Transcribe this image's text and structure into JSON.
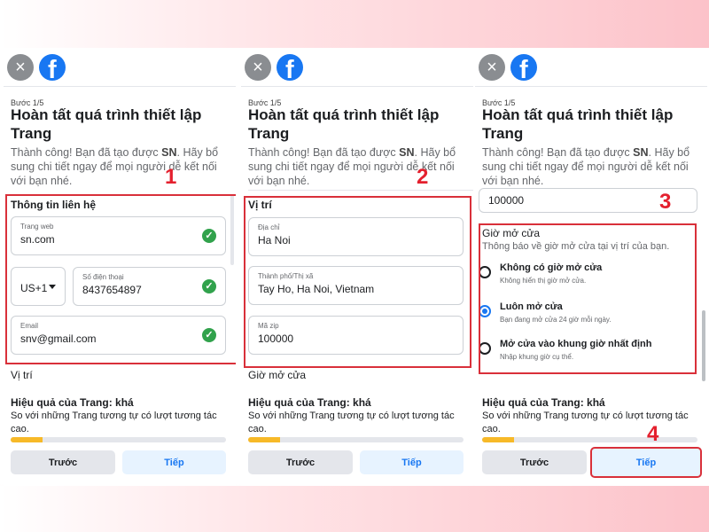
{
  "common": {
    "step": "Bước 1/5",
    "title": "Hoàn tất quá trình thiết lập Trang",
    "subtitle_before": "Thành công! Bạn đã tạo được ",
    "subtitle_bold": "SN",
    "subtitle_after": ". Hãy bổ sung chi tiết ngay để mọi người dễ kết nối với bạn nhé.",
    "perf_title": "Hiệu quả của Trang: khá",
    "perf_text": "So với những Trang tương tự có lượt tương tác cao.",
    "progress_fraction": 0.15,
    "prev_label": "Trước",
    "next_label": "Tiếp",
    "close_icon": "×",
    "fb_letter": "f"
  },
  "panel1": {
    "section_title": "Thông tin liên hệ",
    "website": {
      "label": "Trang web",
      "value": "sn.com"
    },
    "country_code": "US+1",
    "phone": {
      "label": "Số điện thoại",
      "value": "8437654897"
    },
    "email": {
      "label": "Email",
      "value": "snv@gmail.com"
    },
    "next_section": "Vị trí",
    "badge": "1"
  },
  "panel2": {
    "section_title": "Vị trí",
    "address": {
      "label": "Địa chỉ",
      "value": "Ha Noi"
    },
    "city": {
      "label": "Thành phố/Thị xã",
      "value": "Tay Ho, Ha Noi, Vietnam"
    },
    "zip": {
      "label": "Mã zip",
      "value": "100000"
    },
    "next_section": "Giờ mở cửa",
    "badge": "2"
  },
  "panel3": {
    "zip_value": "100000",
    "section_title": "Giờ mở cửa",
    "section_desc": "Thông báo về giờ mở cửa tại vị trí của bạn.",
    "options": [
      {
        "title": "Không có giờ mở cửa",
        "desc": "Không hiển thị giờ mở cửa."
      },
      {
        "title": "Luôn mở cửa",
        "desc": "Bạn đang mở cửa 24 giờ mỗi ngày."
      },
      {
        "title": "Mở cửa vào khung giờ nhất định",
        "desc": "Nhập khung giờ cụ thể."
      }
    ],
    "selected_option": 1,
    "badge3": "3",
    "badge4": "4"
  },
  "colors": {
    "accent": "#1877f2",
    "success": "#31a24c",
    "highlight": "#d9303a",
    "progress": "#f7b928"
  },
  "icons": {
    "close": "close-icon",
    "logo": "facebook-logo-icon",
    "check": "check-circle-icon",
    "dropdown": "caret-down-icon"
  }
}
